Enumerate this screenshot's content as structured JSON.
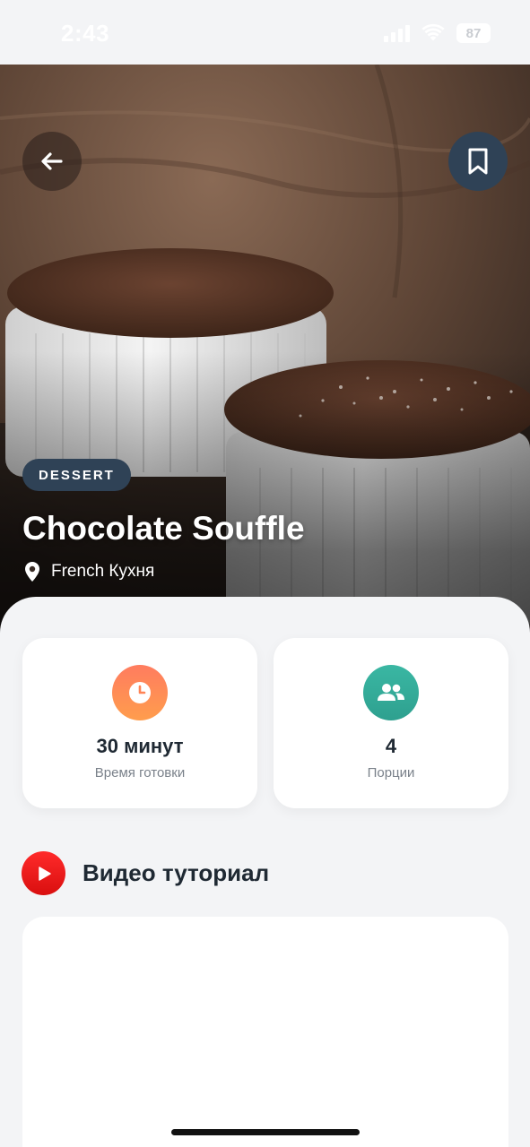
{
  "status_bar": {
    "time": "2:43",
    "battery": "87"
  },
  "hero": {
    "category": "DESSERT",
    "title": "Chocolate Souffle",
    "origin": "French Кухня",
    "back_icon": "arrow-left-icon",
    "bookmark_icon": "bookmark-icon",
    "location_icon": "location-pin-icon"
  },
  "info_cards": [
    {
      "icon": "clock-icon",
      "value": "30 минут",
      "label": "Время готовки",
      "color": "#ff8a55"
    },
    {
      "icon": "people-icon",
      "value": "4",
      "label": "Порции",
      "color": "#35ad9a"
    }
  ],
  "video_section": {
    "icon": "youtube-play-icon",
    "title": "Видео туториал",
    "accent": "#e81313"
  },
  "colors": {
    "background": "#f3f4f6",
    "badge": "#2f4256",
    "text_dark": "#1f2933",
    "text_muted": "#7a818a"
  }
}
